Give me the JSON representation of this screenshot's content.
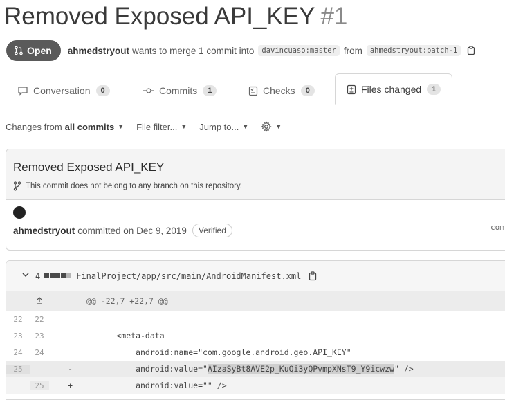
{
  "pr": {
    "title": "Removed Exposed API_KEY",
    "number": "#1",
    "state": "Open",
    "author": "ahmedstryout",
    "merge_text": "wants to merge 1 commit into",
    "base_ref": "davincuaso:master",
    "from_text": "from",
    "head_ref": "ahmedstryout:patch-1"
  },
  "tabs": [
    {
      "label": "Conversation",
      "count": "0",
      "icon": "comment-icon"
    },
    {
      "label": "Commits",
      "count": "1",
      "icon": "commit-icon"
    },
    {
      "label": "Checks",
      "count": "0",
      "icon": "checklist-icon"
    },
    {
      "label": "Files changed",
      "count": "1",
      "icon": "diff-icon"
    }
  ],
  "toolbar": {
    "changes_prefix": "Changes from",
    "changes_value": "all commits",
    "file_filter": "File filter...",
    "jump_to": "Jump to...",
    "settings_icon": "gear-icon"
  },
  "commit": {
    "title": "Removed Exposed API_KEY",
    "note": "This commit does not belong to any branch on this repository.",
    "author": "ahmedstryout",
    "committed_text": "committed on Dec 9, 2019",
    "verified": "Verified",
    "sha_partial": "com"
  },
  "file": {
    "changes": "4",
    "path": "FinalProject/app/src/main/AndroidManifest.xml",
    "hunk_header": "@@ -22,7 +22,7 @@",
    "lines": [
      {
        "old": "22",
        "new": "22",
        "sign": "",
        "code": ""
      },
      {
        "old": "23",
        "new": "23",
        "sign": "",
        "code": "        <meta-data"
      },
      {
        "old": "24",
        "new": "24",
        "sign": "",
        "code": "            android:name=\"com.google.android.geo.API_KEY\""
      },
      {
        "old": "25",
        "new": "",
        "sign": "-",
        "code_pre": "            android:value=\"",
        "code_hl": "AIzaSyBt8AVE2p_KuQi3yQPvmpXNsT9_Y9icwzw",
        "code_post": "\" />"
      },
      {
        "old": "",
        "new": "25",
        "sign": "+",
        "code": "            android:value=\"\" />"
      }
    ]
  },
  "colors": {
    "accent": "#5a5a5a",
    "border": "#d6d6d6"
  }
}
